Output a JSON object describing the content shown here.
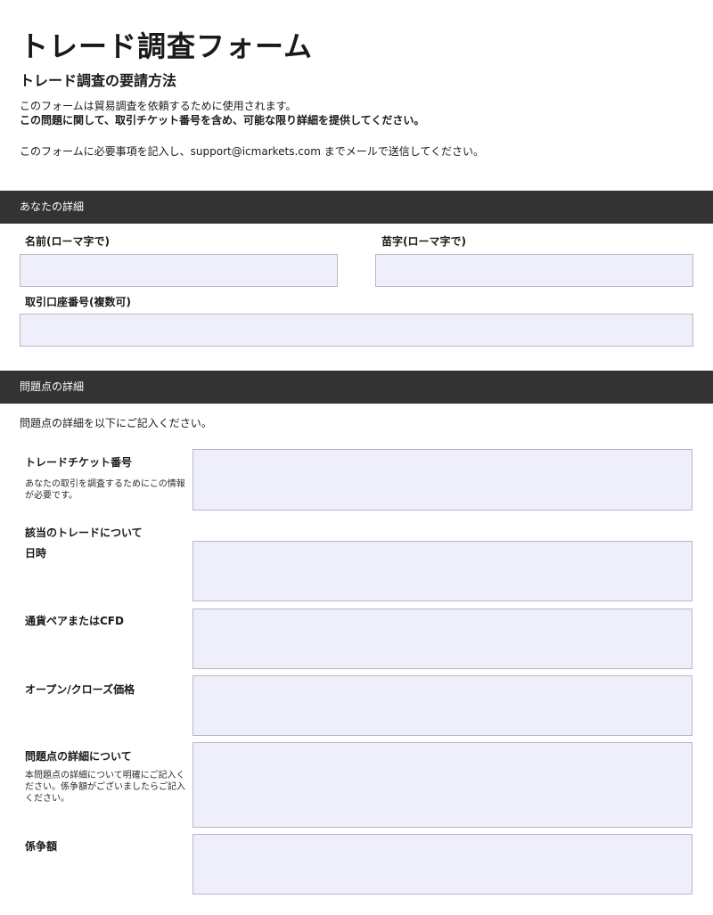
{
  "header": {
    "title": "トレード調査フォーム",
    "subtitle": "トレード調査の要請方法",
    "intro_line1": "このフォームは貿易調査を依頼するために使用されます。",
    "intro_line2": "この問題に関して、取引チケット番号を含め、可能な限り詳細を提供してください。",
    "intro_line3": "このフォームに必要事項を記入し、support@icmarkets.com までメールで送信してください。"
  },
  "section_your_details": {
    "heading": "あなたの詳細",
    "first_name_label": "名前(ローマ字で)",
    "last_name_label": "苗字(ローマ字で)",
    "account_label": "取引口座番号(複数可)"
  },
  "section_issue_details": {
    "heading": "問題点の詳細",
    "intro": "問題点の詳細を以下にご記入ください。",
    "ticket_label": "トレードチケット番号",
    "ticket_help": "あなたの取引を調査するためにこの情報が必要です。",
    "about_trade_label": "該当のトレードについて",
    "datetime_label": "日時",
    "pair_label": "通貨ペアまたはCFD",
    "price_label": "オープン/クローズ価格",
    "details_label": "問題点の詳細について",
    "details_help": "本問題点の詳細について明確にご記入ください。係争額がございましたらご記入ください。",
    "dispute_label": "係争額"
  },
  "colors": {
    "section_bar": "#333333",
    "input_fill": "#efeffc",
    "input_border": "#b7b7c7"
  }
}
